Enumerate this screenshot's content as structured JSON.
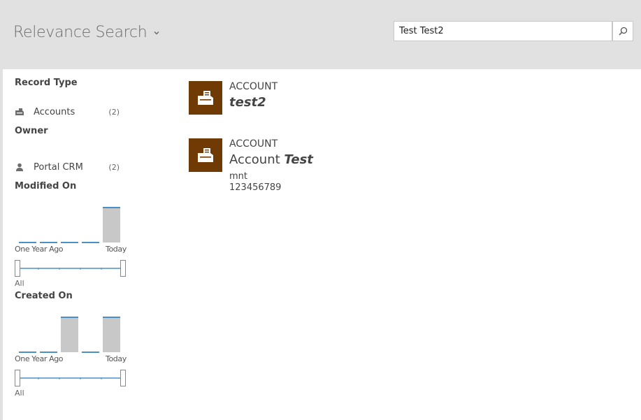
{
  "header": {
    "title": "Relevance Search",
    "search_value": "Test Test2",
    "search_icon": "search-icon",
    "dropdown_icon": "chevron-down-icon"
  },
  "colors": {
    "header_bg": "#e1e1e1",
    "tile_bg": "#6f3a04",
    "bar_fill": "#c8c8c8",
    "bar_accent": "#4a90c8"
  },
  "facets": {
    "record_type": {
      "title": "Record Type",
      "items": [
        {
          "label": "Accounts",
          "count": "(2)",
          "icon": "account-icon"
        }
      ]
    },
    "owner": {
      "title": "Owner",
      "items": [
        {
          "label": "Portal CRM",
          "count": "(2)",
          "icon": "user-icon"
        }
      ]
    },
    "modified_on": {
      "title": "Modified On",
      "start_label": "One Year Ago",
      "end_label": "Today",
      "all_label": "All"
    },
    "created_on": {
      "title": "Created On",
      "start_label": "One Year Ago",
      "end_label": "Today",
      "all_label": "All"
    }
  },
  "chart_data": [
    {
      "type": "bar",
      "title": "Modified On",
      "categories": [
        "1",
        "2",
        "3",
        "4",
        "5"
      ],
      "values": [
        0,
        0,
        0,
        0,
        1
      ]
    },
    {
      "type": "bar",
      "title": "Created On",
      "categories": [
        "1",
        "2",
        "3",
        "4",
        "5"
      ],
      "values": [
        0,
        0,
        1,
        0,
        1
      ]
    }
  ],
  "results": [
    {
      "entity": "ACCOUNT",
      "name_plain": "",
      "name_bold": "test2",
      "lines": []
    },
    {
      "entity": "ACCOUNT",
      "name_plain": "Account ",
      "name_bold": "Test",
      "lines": [
        "mnt",
        "123456789"
      ]
    }
  ]
}
